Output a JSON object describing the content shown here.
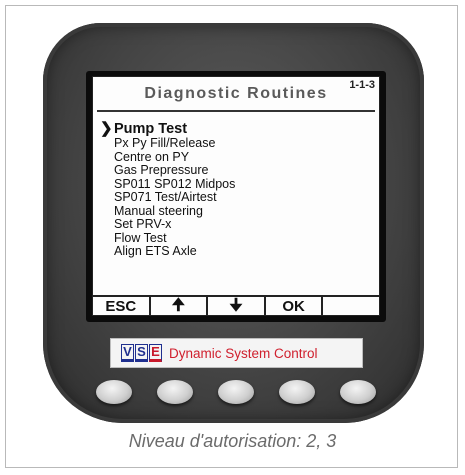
{
  "screen": {
    "title": "Diagnostic Routines",
    "code": "1-1-3",
    "selected_marker": "❯",
    "menu": [
      {
        "label": "Pump Test",
        "selected": true
      },
      {
        "label": "Px Py Fill/Release"
      },
      {
        "label": "Centre on  PY"
      },
      {
        "label": "Gas Prepressure"
      },
      {
        "label": "SP011 SP012 Midpos"
      },
      {
        "label": "SP071 Test/Airtest"
      },
      {
        "label": "Manual steering"
      },
      {
        "label": "Set PRV-x"
      },
      {
        "label": "Flow Test"
      },
      {
        "label": "Align ETS Axle"
      }
    ],
    "softkeys": {
      "esc": "ESC",
      "up": "🠉",
      "down": "🠋",
      "ok": "OK",
      "blank": ""
    }
  },
  "brand": {
    "logo_letters": [
      "V",
      "S",
      "E"
    ],
    "text": "Dynamic System Control"
  },
  "caption": "Niveau d'autorisation: 2, 3"
}
